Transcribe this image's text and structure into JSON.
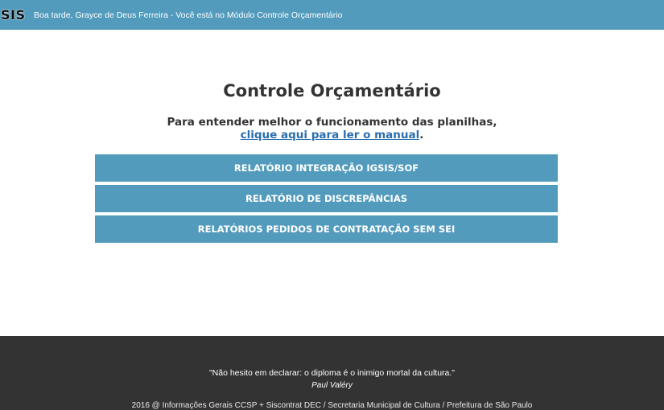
{
  "header": {
    "logo": "SIS",
    "greeting": "Boa tarde, Grayce de Deus Ferreira - Você está no Módulo Controle Orçamentário"
  },
  "main": {
    "title": "Controle Orçamentário",
    "intro_text": "Para entender melhor o funcionamento das planilhas,",
    "manual_link": "clique aqui para ler o manual",
    "manual_suffix": ".",
    "buttons": [
      {
        "label": "RELATÓRIO INTEGRAÇÃO IGSIS/SOF"
      },
      {
        "label": "RELATÓRIO DE DISCREPÂNCIAS"
      },
      {
        "label": "RELATÓRIOS PEDIDOS DE CONTRATAÇÃO SEM SEI"
      }
    ]
  },
  "footer": {
    "quote": "\"Não hesito em declarar: o diploma é o inimigo mortal da cultura.\"",
    "author": "Paul Valéry",
    "copyright": "2016 @ Informações Gerais CCSP + Siscontrat DEC / Secretaria Municipal de Cultura / Prefeitura de São Paulo"
  },
  "colors": {
    "primary": "#529bbd",
    "footer_bg": "#333333",
    "title_text": "#333333",
    "link": "#2a6db0"
  }
}
